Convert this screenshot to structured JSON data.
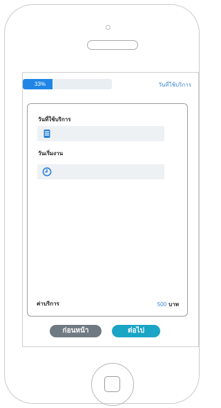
{
  "progress": {
    "percent": 33,
    "label": "33%"
  },
  "header": {
    "step_title": "วันที่ใช้บริการ"
  },
  "form": {
    "service_date": {
      "label": "วันที่ใช้บริการ",
      "value": "",
      "icon": "calendar-icon"
    },
    "start_time": {
      "label": "วันเริ่มงาน",
      "value": "",
      "icon": "clock-icon"
    },
    "fee": {
      "label": "ค่าบริการ",
      "amount": "500",
      "unit": "บาท"
    }
  },
  "buttons": {
    "back_label": "ก่อนหน้า",
    "next_label": "ต่อไป"
  },
  "colors": {
    "progress_fill": "#1f86e6",
    "accent_text": "#3a86d6",
    "back_button": "#707a82",
    "next_button": "#1aa5c5"
  }
}
